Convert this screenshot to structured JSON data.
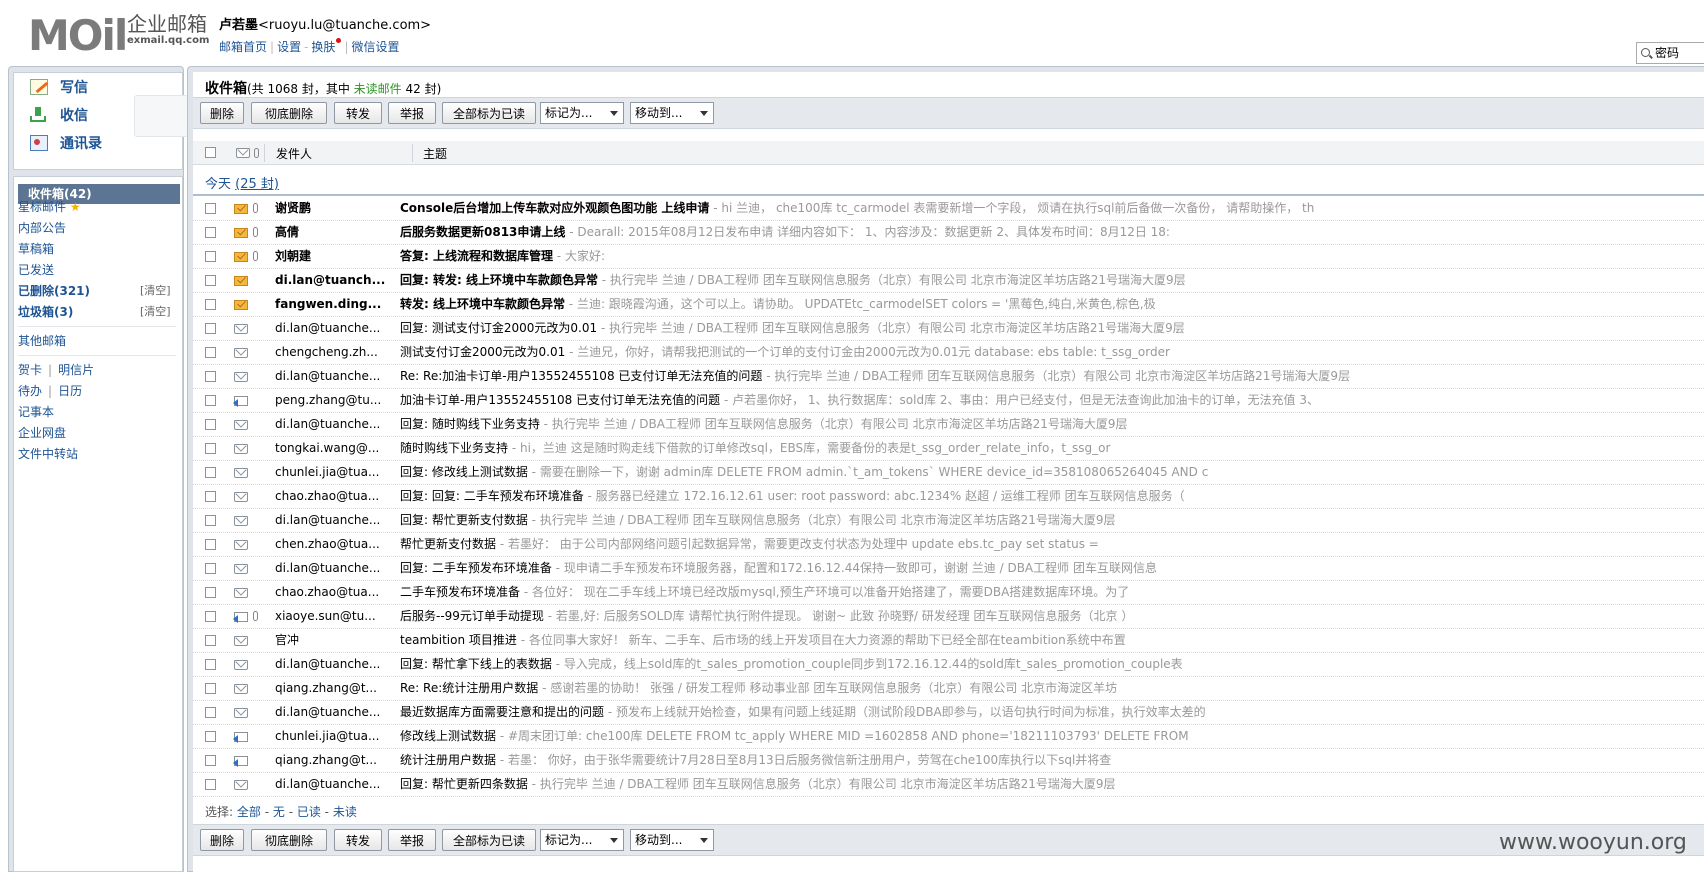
{
  "brand": {
    "logo_text": "MOil",
    "name_cn": "企业邮箱",
    "url": "exmail.qq.com"
  },
  "user": {
    "name": "卢若墨",
    "email": "<ruoyu.lu@tuanche.com>",
    "links": [
      "邮箱首页",
      "设置",
      "换肤",
      "微信设置"
    ]
  },
  "search": {
    "placeholder": "密码"
  },
  "quick": {
    "write": "写信",
    "receive": "收信",
    "contacts": "通讯录"
  },
  "folders": {
    "inbox": "收件箱(42)",
    "starred": "星标邮件",
    "internal": "内部公告",
    "drafts": "草稿箱",
    "sent": "已发送",
    "deleted": "已删除(321)",
    "spam": "垃圾箱(3)",
    "clear": "[清空]",
    "other": "其他邮箱",
    "card": "贺卡",
    "postcard": "明信片",
    "todo": "待办",
    "calendar": "日历",
    "notes": "记事本",
    "disk": "企业网盘",
    "transfer": "文件中转站"
  },
  "list": {
    "title": "收件箱",
    "summary_prefix": "(共 1068 封，其中 ",
    "unread_label": "未读邮件",
    "summary_suffix": " 42 封)",
    "header_sender": "发件人",
    "header_subject": "主题",
    "today_label": "今天",
    "today_count": "(25 封)"
  },
  "toolbar": {
    "delete": "删除",
    "perm_delete": "彻底删除",
    "forward": "转发",
    "report": "举报",
    "mark_all_read": "全部标为已读",
    "mark_as": "标记为...",
    "move_to": "移动到..."
  },
  "select_bar": {
    "label": "选择:",
    "all": "全部",
    "none": "无",
    "read": "已读",
    "unread": "未读"
  },
  "emails": [
    {
      "sender": "谢贤鹏",
      "subject": "Console后台增加上传车款对应外观颜色图功能 上线申请",
      "snippet": " - hi 兰迪， che100库 tc_carmodel 表需要新增一个字段， 烦请在执行sql前后备做一次备份， 请帮助操作， th",
      "unread": true,
      "attach": true,
      "icon": "unread"
    },
    {
      "sender": "高倩",
      "subject": "后服务数据更新0813申请上线",
      "snippet": " - Dearall:  2015年08月12日发布申请 详细内容如下： 1、内容涉及：数据更新 2、具体发布时间：8月12日 18:",
      "unread": true,
      "attach": true,
      "icon": "unread"
    },
    {
      "sender": "刘朝建",
      "subject": "答复: 上线流程和数据库管理",
      "snippet": " - 大家好:",
      "unread": true,
      "attach": true,
      "icon": "unread"
    },
    {
      "sender": "di.lan@tuanch...",
      "subject": "回复: 转发: 线上环境中车款颜色异常",
      "snippet": " - 执行完毕 兰迪 / DBA工程师 团车互联网信息服务（北京）有限公司 北京市海淀区羊坊店路21号瑞海大厦9层",
      "unread": true,
      "attach": false,
      "icon": "unread"
    },
    {
      "sender": "fangwen.ding...",
      "subject": "转发: 线上环境中车款颜色异常",
      "snippet": " - 兰迪:  跟晓霞沟通，这个可以上。请协助。 UPDATEtc_carmodelSET colors = '黑莓色,纯白,米黄色,棕色,极",
      "unread": true,
      "attach": false,
      "icon": "unread"
    },
    {
      "sender": "di.lan@tuanche...",
      "subject": "回复: 测试支付订金2000元改为0.01",
      "snippet": " - 执行完毕 兰迪 / DBA工程师 团车互联网信息服务（北京）有限公司 北京市海淀区羊坊店路21号瑞海大厦9层",
      "unread": false,
      "attach": false,
      "icon": "read"
    },
    {
      "sender": "chengcheng.zh...",
      "subject": "测试支付订金2000元改为0.01",
      "snippet": " - 兰迪兄，你好，请帮我把测试的一个订单的支付订金由2000元改为0.01元 database: ebs table: t_ssg_order",
      "unread": false,
      "attach": false,
      "icon": "read"
    },
    {
      "sender": "di.lan@tuanche...",
      "subject": "Re: Re:加油卡订单-用户13552455108 已支付订单无法充值的问题",
      "snippet": " - 执行完毕 兰迪 / DBA工程师 团车互联网信息服务（北京）有限公司 北京市海淀区羊坊店路21号瑞海大厦9层",
      "unread": false,
      "attach": false,
      "icon": "read"
    },
    {
      "sender": "peng.zhang@tu...",
      "subject": "加油卡订单-用户13552455108 已支付订单无法充值的问题",
      "snippet": " - 卢若墨你好， 1、执行数据库：sold库 2、事由：用户已经支付，但是无法查询此加油卡的订单，无法充值 3、",
      "unread": false,
      "attach": false,
      "icon": "replied"
    },
    {
      "sender": "di.lan@tuanche...",
      "subject": "回复: 随时购线下业务支持",
      "snippet": " - 执行完毕 兰迪 / DBA工程师 团车互联网信息服务（北京）有限公司 北京市海淀区羊坊店路21号瑞海大厦9层",
      "unread": false,
      "attach": false,
      "icon": "read"
    },
    {
      "sender": "tongkai.wang@...",
      "subject": "随时购线下业务支持",
      "snippet": " - hi，兰迪 这是随时购走线下借款的订单修改sql，EBS库，需要备份的表是t_ssg_order_relate_info，t_ssg_or",
      "unread": false,
      "attach": false,
      "icon": "read"
    },
    {
      "sender": "chunlei.jia@tua...",
      "subject": "回复: 修改线上测试数据",
      "snippet": " - 需要在删除一下，谢谢 admin库 DELETE FROM admin.`t_am_tokens` WHERE device_id=358108065264045 AND c",
      "unread": false,
      "attach": false,
      "icon": "read"
    },
    {
      "sender": "chao.zhao@tua...",
      "subject": "回复: 回复: 二手车预发布环境准备",
      "snippet": " - 服务器已经建立 172.16.12.61 user: root password: abc.1234% 赵超 / 运维工程师 团车互联网信息服务（",
      "unread": false,
      "attach": false,
      "icon": "read"
    },
    {
      "sender": "di.lan@tuanche...",
      "subject": "回复: 帮忙更新支付数据",
      "snippet": " - 执行完毕 兰迪 / DBA工程师 团车互联网信息服务（北京）有限公司 北京市海淀区羊坊店路21号瑞海大厦9层",
      "unread": false,
      "attach": false,
      "icon": "read"
    },
    {
      "sender": "chen.zhao@tua...",
      "subject": "帮忙更新支付数据",
      "snippet": " - 若墨好： 由于公司内部网络问题引起数据异常，需要更改支付状态为处理中 update ebs.tc_pay set status =",
      "unread": false,
      "attach": false,
      "icon": "read"
    },
    {
      "sender": "di.lan@tuanche...",
      "subject": "回复: 二手车预发布环境准备",
      "snippet": " - 现申请二手车预发布环境服务器，配置和172.16.12.44保持一致即可，谢谢 兰迪 / DBA工程师 团车互联网信息",
      "unread": false,
      "attach": false,
      "icon": "read"
    },
    {
      "sender": "chao.zhao@tua...",
      "subject": "二手车预发布环境准备",
      "snippet": " - 各位好： 现在二手车线上环境已经改版mysql,预生产环境可以准备开始搭建了，需要DBA搭建数据库环境。为了",
      "unread": false,
      "attach": false,
      "icon": "read"
    },
    {
      "sender": "xiaoye.sun@tu...",
      "subject": "后服务--99元订单手动提现",
      "snippet": " - 若墨,好: 后服务SOLD库 请帮忙执行附件提现。 谢谢~ 此致 孙晓野/ 研发经理 团车互联网信息服务（北京 ）",
      "unread": false,
      "attach": true,
      "icon": "replied"
    },
    {
      "sender": "官冲",
      "subject": "teambition 项目推进",
      "snippet": " - 各位同事大家好！ 新车、二手车、后市场的线上开发项目在大力资源的帮助下已经全部在teambition系统中布置",
      "unread": false,
      "attach": false,
      "icon": "read"
    },
    {
      "sender": "di.lan@tuanche...",
      "subject": "回复: 帮忙拿下线上的表数据",
      "snippet": " - 导入完成，线上sold库的t_sales_promotion_couple同步到172.16.12.44的sold库t_sales_promotion_couple表",
      "unread": false,
      "attach": false,
      "icon": "read"
    },
    {
      "sender": "qiang.zhang@t...",
      "subject": "Re: Re:统计注册用户数据",
      "snippet": " - 感谢若墨的协助！ 张强 / 研发工程师 移动事业部 团车互联网信息服务（北京）有限公司 北京市海淀区羊坊",
      "unread": false,
      "attach": false,
      "icon": "read"
    },
    {
      "sender": "di.lan@tuanche...",
      "subject": "最近数据库方面需要注意和提出的问题",
      "snippet": " - 预发布上线就开始检查，如果有问题上线延期（测试阶段DBA即参与，以语句执行时间为标准，执行效率太差的",
      "unread": false,
      "attach": false,
      "icon": "read"
    },
    {
      "sender": "chunlei.jia@tua...",
      "subject": "修改线上测试数据",
      "snippet": " - #周末团订单: che100库 DELETE FROM tc_apply WHERE MID =1602858 AND phone='18211103793' DELETE FROM",
      "unread": false,
      "attach": false,
      "icon": "replied"
    },
    {
      "sender": "qiang.zhang@t...",
      "subject": "统计注册用户数据",
      "snippet": " - 若墨： 你好，由于张华需要统计7月28日至8月13日后服务微信新注册用户，劳驾在che100库执行以下sql并将查",
      "unread": false,
      "attach": false,
      "icon": "replied"
    },
    {
      "sender": "di.lan@tuanche...",
      "subject": "回复: 帮忙更新四条数据",
      "snippet": " - 执行完毕 兰迪 / DBA工程师 团车互联网信息服务（北京）有限公司 北京市海淀区羊坊店路21号瑞海大厦9层",
      "unread": false,
      "attach": false,
      "icon": "read"
    }
  ],
  "watermark": "www.wooyun.org"
}
